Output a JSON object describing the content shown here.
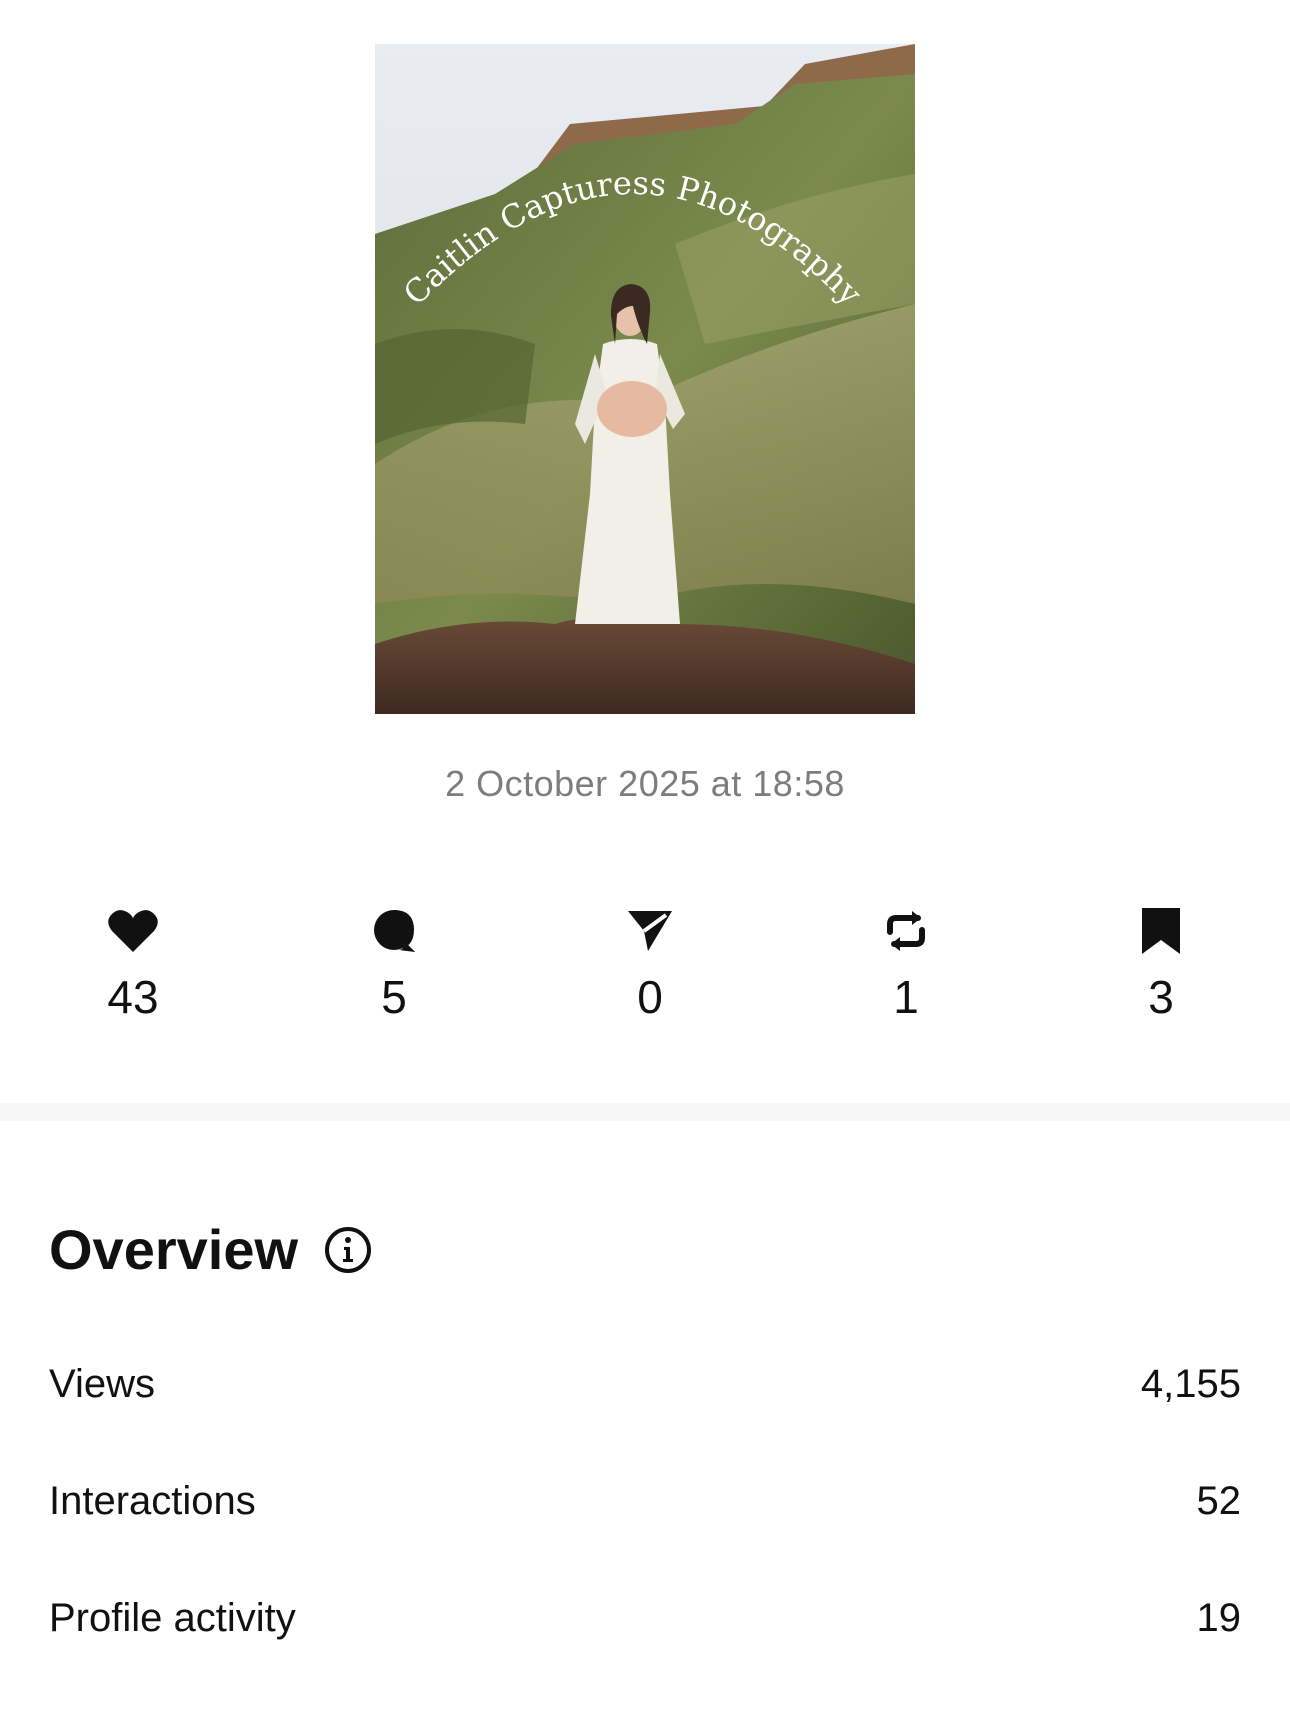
{
  "post": {
    "image_watermark": "Caitlin Capturess Photography",
    "timestamp": "2 October 2025 at 18:58"
  },
  "engagement": [
    {
      "icon": "heart-icon",
      "count": "43"
    },
    {
      "icon": "comment-icon",
      "count": "5"
    },
    {
      "icon": "share-icon",
      "count": "0"
    },
    {
      "icon": "repost-icon",
      "count": "1"
    },
    {
      "icon": "bookmark-icon",
      "count": "3"
    }
  ],
  "overview": {
    "title": "Overview",
    "info_icon": "info-icon",
    "metrics": [
      {
        "label": "Views",
        "value": "4,155"
      },
      {
        "label": "Interactions",
        "value": "52"
      },
      {
        "label": "Profile activity",
        "value": "19"
      }
    ]
  }
}
